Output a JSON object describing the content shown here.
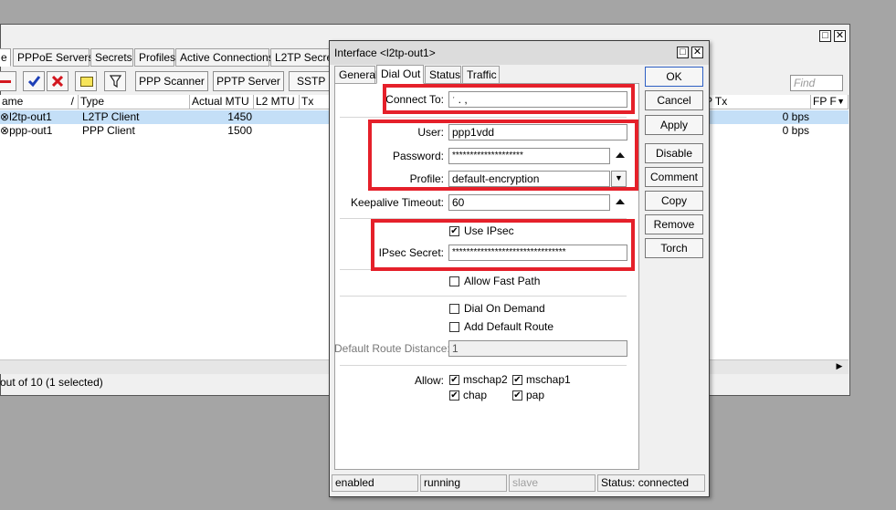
{
  "bg_window": {
    "tabs": [
      "PPPoE Servers",
      "Secrets",
      "Profiles",
      "Active Connections",
      "L2TP Secrets"
    ],
    "toolbar": {
      "scanner_label": "PPP Scanner",
      "pptp_label": "PPTP Server",
      "sstp_label": "SSTP S"
    },
    "find_placeholder": "Find",
    "columns": {
      "name": "ame",
      "type": "Type",
      "actual_mtu": "Actual MTU",
      "l2_mtu": "L2 MTU",
      "tx": "Tx",
      "p_tx": "P Tx",
      "fp": "FP F"
    },
    "rows": [
      {
        "name": "l2tp-out1",
        "type": "L2TP Client",
        "mtu": "1450",
        "rate": "0 bps",
        "selected": true
      },
      {
        "name": "ppp-out1",
        "type": "PPP Client",
        "mtu": "1500",
        "rate": "0 bps",
        "selected": false
      }
    ],
    "status": "out of 10 (1 selected)"
  },
  "dialog": {
    "title": "Interface <l2tp-out1>",
    "tabs": [
      "General",
      "Dial Out",
      "Status",
      "Traffic"
    ],
    "active_tab": "Dial Out",
    "connect_to": {
      "label": "Connect To:",
      "value": "ˑ       .  ,"
    },
    "user": {
      "label": "User:",
      "value": "ppp1vdd"
    },
    "password": {
      "label": "Password:",
      "value": "********************"
    },
    "profile": {
      "label": "Profile:",
      "value": "default-encryption"
    },
    "keepalive": {
      "label": "Keepalive Timeout:",
      "value": "60"
    },
    "use_ipsec": {
      "label": "Use IPsec",
      "checked": true
    },
    "ipsec_secret": {
      "label": "IPsec Secret:",
      "value": "********************************"
    },
    "allow_fast_path": {
      "label": "Allow Fast Path",
      "checked": false
    },
    "dial_on_demand": {
      "label": "Dial On Demand",
      "checked": false
    },
    "add_default_route": {
      "label": "Add Default Route",
      "checked": false
    },
    "default_route_distance": {
      "label": "Default Route Distance:",
      "value": "1"
    },
    "allow": {
      "label": "Allow:",
      "options": [
        {
          "label": "mschap2",
          "checked": true
        },
        {
          "label": "mschap1",
          "checked": true
        },
        {
          "label": "chap",
          "checked": true
        },
        {
          "label": "pap",
          "checked": true
        }
      ]
    },
    "buttons": [
      "OK",
      "Cancel",
      "Apply",
      "Disable",
      "Comment",
      "Copy",
      "Remove",
      "Torch"
    ],
    "status_bar": [
      "enabled",
      "running",
      "slave",
      "Status: connected"
    ],
    "highlight_color": "#e5202a"
  }
}
